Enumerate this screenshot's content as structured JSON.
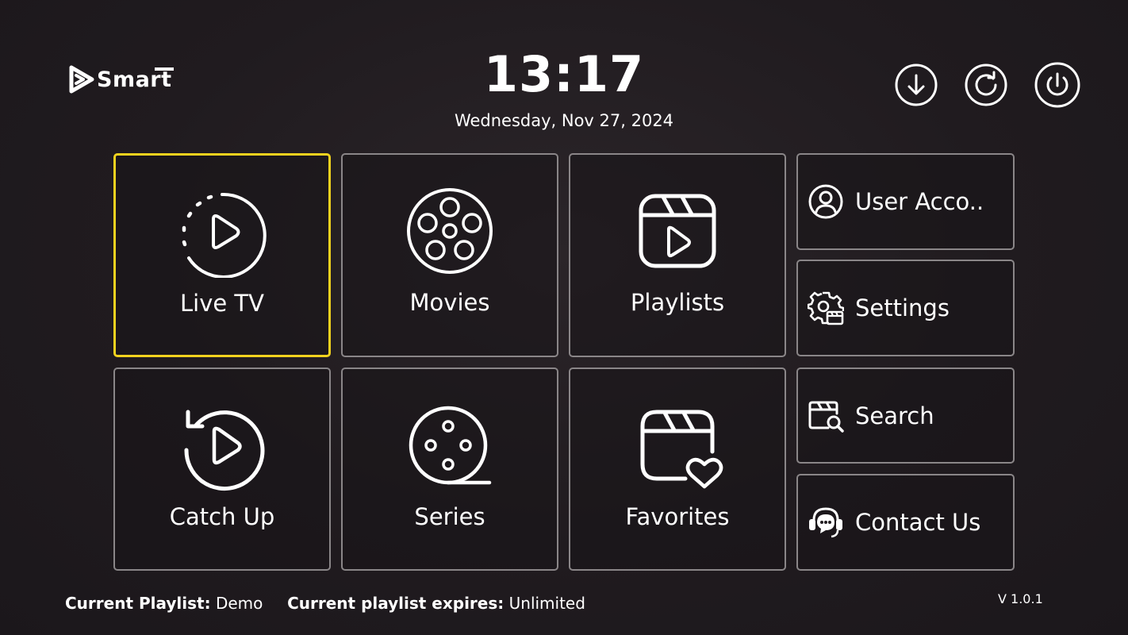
{
  "header": {
    "logo_text": "Smart",
    "time": "13:17",
    "date": "Wednesday, Nov 27, 2024",
    "buttons": [
      {
        "name": "download-button",
        "icon": "download-icon"
      },
      {
        "name": "refresh-button",
        "icon": "refresh-icon"
      },
      {
        "name": "power-button",
        "icon": "power-icon"
      }
    ]
  },
  "tiles": {
    "live_tv": {
      "label": "Live TV",
      "icon": "live-play-icon",
      "focused": true
    },
    "movies": {
      "label": "Movies",
      "icon": "film-reel-icon"
    },
    "playlists": {
      "label": "Playlists",
      "icon": "clapperboard-play-icon"
    },
    "catch_up": {
      "label": "Catch Up",
      "icon": "replay-icon"
    },
    "series": {
      "label": "Series",
      "icon": "film-roll-icon"
    },
    "favorites": {
      "label": "Favorites",
      "icon": "clapperboard-heart-icon"
    },
    "user_account": {
      "label": "User Acco..",
      "icon": "user-icon"
    },
    "settings": {
      "label": "Settings",
      "icon": "gear-icon"
    },
    "search": {
      "label": "Search",
      "icon": "search-icon"
    },
    "contact_us": {
      "label": "Contact Us",
      "icon": "headset-icon"
    }
  },
  "footer": {
    "playlist_key": "Current Playlist:",
    "playlist_value": "Demo",
    "expires_key": "Current playlist expires:",
    "expires_value": "Unlimited",
    "version": "V 1.0.1"
  },
  "colors": {
    "focus": "#f2d21e",
    "tile_border": "#8a8688",
    "background": "#201b1f",
    "text": "#ffffff"
  }
}
